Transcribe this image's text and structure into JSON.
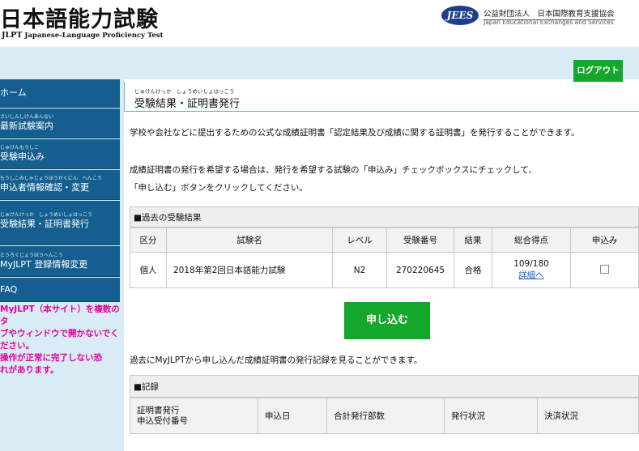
{
  "header": {
    "logo_title": "日本語能力試験",
    "logo_abbr": "JLPT",
    "logo_sub": "Japanese-Language Proficiency Test",
    "org_badge": "JEES",
    "org_name_jp": "公益財団法人　日本国際教育支援協会",
    "org_name_en": "Japan Educational Exchanges and Services"
  },
  "topbar": {
    "logout_label": "ログアウト"
  },
  "sidebar": {
    "items": [
      {
        "ruby": "",
        "label": "ホーム"
      },
      {
        "ruby": "さいしんしけんあんない",
        "label": "最新試験案内"
      },
      {
        "ruby": "じゅけんもうしこ",
        "label": "受験申込み"
      },
      {
        "ruby": "もうしこみしゃじょうほうかくにん　へんこう",
        "label": "申込者情報確認・変更"
      },
      {
        "ruby": "じゅけんけっか　しょうめいしょはっこう",
        "label": "受験結果・証明書発行"
      },
      {
        "ruby": "とうろくじょうほうへんこう",
        "label": "MyJLPT 登録情報変更"
      },
      {
        "ruby": "",
        "label": "FAQ"
      }
    ],
    "notice": [
      "MyJLPT（本サイト）を複数のタ",
      "ブやウィンドウで開かないでく",
      "ださい。",
      "操作が正常に完了しない恐",
      "れがあります。"
    ]
  },
  "page": {
    "title_ruby": "じゅけんけっか　しょうめいしょはっこう",
    "title": "受験結果・証明書発行",
    "intro": "学校や会社などに提出するための公式な成績証明書「認定結果及び成績に関する証明書」を発行することができます。",
    "instr1": "成績証明書の発行を希望する場合は、発行を希望する試験の「申込み」チェックボックスにチェックして、",
    "instr2": "「申し込む」ボタンをクリックしてください。",
    "past_results_heading": "■過去の受験結果",
    "results_columns": [
      "区分",
      "試験名",
      "レベル",
      "受験番号",
      "結果",
      "総合得点",
      "申込み"
    ],
    "results_rows": [
      {
        "category": "個人",
        "exam": "2018年第2回日本語能力試験",
        "level": "N2",
        "number": "270220645",
        "result": "合格",
        "score": "109/180",
        "detail": "詳細へ"
      }
    ],
    "apply_label": "申し込む",
    "history_note": "過去にMyJLPTから申し込んだ成績証明書の発行記録を見ることができます。",
    "record_heading": "■記録",
    "record_columns": [
      "証明書発行",
      "申込日",
      "合計発行部数",
      "発行状況",
      "決済状況"
    ],
    "record_col1_sub": "申込受付番号"
  },
  "colors": {
    "nav_bg": "#155f90",
    "band_bg": "#d9ecf6",
    "button_green": "#14a72b",
    "notice_pink": "#e6009a"
  }
}
